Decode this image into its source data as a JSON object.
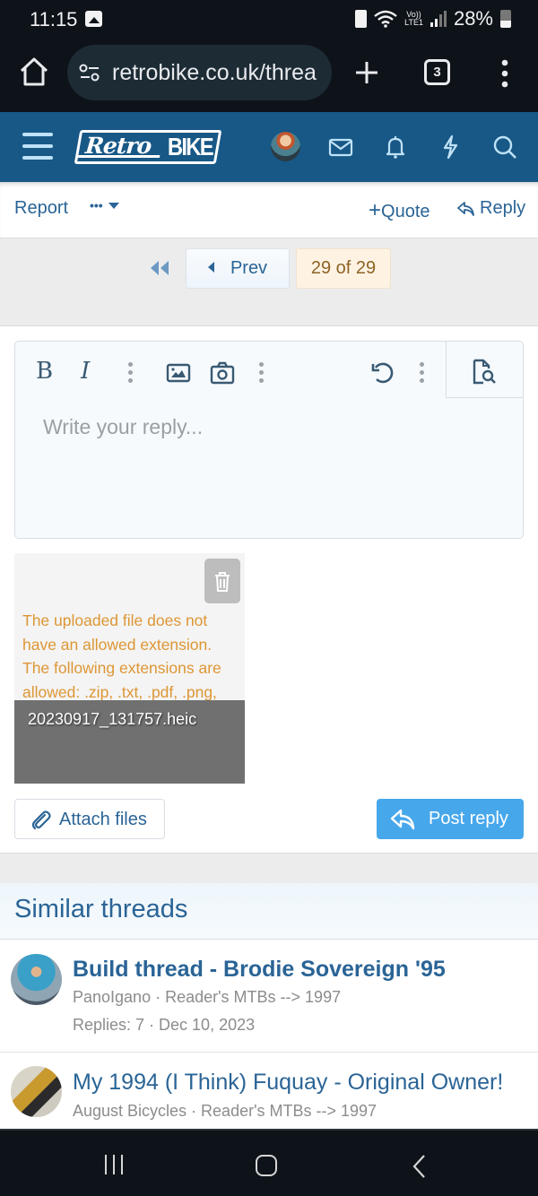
{
  "status_bar": {
    "time": "11:15",
    "network_label_top": "Vo))",
    "network_label_bottom": "LTE1",
    "battery_percent": "28%"
  },
  "browser": {
    "url": "retrobike.co.uk/threa",
    "tab_count": "3"
  },
  "site_header": {
    "logo_part1": "Retro",
    "logo_part2": "BIKE",
    "icons": [
      "menu-icon",
      "avatar",
      "mail-icon",
      "bell-icon",
      "lightning-icon",
      "search-icon"
    ]
  },
  "post_actions": {
    "report": "Report",
    "more": "•••",
    "quote": "Quote",
    "reply": "Reply"
  },
  "pager": {
    "prev": "Prev",
    "current": "29 of 29"
  },
  "editor": {
    "bold": "B",
    "italic": "I",
    "placeholder": "Write your reply..."
  },
  "attachment": {
    "error": "The uploaded file does not have an allowed extension. The following extensions are allowed: .zip, .txt, .pdf, .png,",
    "filename": "20230917_131757.heic"
  },
  "buttons": {
    "attach_files": "Attach files",
    "post_reply": "Post reply"
  },
  "similar_threads": {
    "heading": "Similar threads",
    "items": [
      {
        "title": "Build thread - Brodie Sovereign '95",
        "meta": "PanoIgano · Reader's MTBs --> 1997",
        "stats": "Replies: 7 · Dec 10, 2023"
      },
      {
        "title": "My 1994 (I Think) Fuquay - Original Owner!",
        "meta": "August Bicycles · Reader's MTBs --> 1997"
      }
    ]
  },
  "colors": {
    "header_bg": "#185886",
    "link": "#2a6496",
    "primary_button": "#47a7eb",
    "error_text": "#dd9634",
    "page_current_bg": "#fef3e3"
  }
}
